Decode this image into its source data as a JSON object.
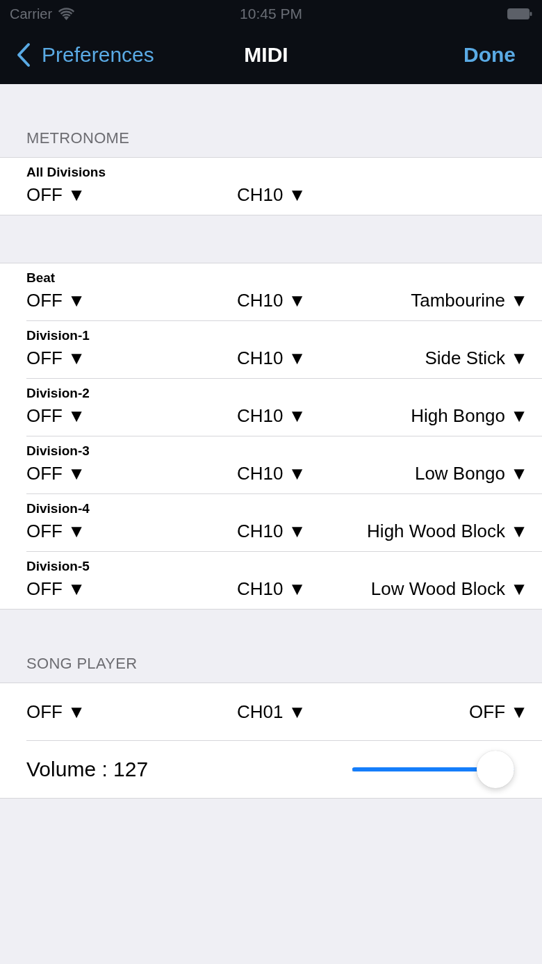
{
  "status_bar": {
    "carrier": "Carrier",
    "time": "10:45 PM"
  },
  "nav_bar": {
    "back": "Preferences",
    "title": "MIDI",
    "done": "Done"
  },
  "sections": [
    {
      "header": "METRONOME",
      "rows": [
        {
          "kind": "pickers",
          "label": "All Divisions",
          "values": [
            "OFF ▼",
            "CH10 ▼"
          ]
        }
      ]
    },
    {
      "rows": [
        {
          "kind": "pickers",
          "label": "Beat",
          "values": [
            "OFF ▼",
            "CH10 ▼",
            "Tambourine ▼"
          ]
        },
        {
          "kind": "pickers",
          "label": "Division-1",
          "values": [
            "OFF ▼",
            "CH10 ▼",
            "Side Stick ▼"
          ]
        },
        {
          "kind": "pickers",
          "label": "Division-2",
          "values": [
            "OFF ▼",
            "CH10 ▼",
            "High Bongo ▼"
          ]
        },
        {
          "kind": "pickers",
          "label": "Division-3",
          "values": [
            "OFF ▼",
            "CH10 ▼",
            "Low Bongo ▼"
          ]
        },
        {
          "kind": "pickers",
          "label": "Division-4",
          "values": [
            "OFF ▼",
            "CH10 ▼",
            "High Wood Block ▼"
          ]
        },
        {
          "kind": "pickers",
          "label": "Division-5",
          "values": [
            "OFF ▼",
            "CH10 ▼",
            "Low Wood Block ▼"
          ]
        }
      ]
    },
    {
      "header": "SONG PLAYER",
      "rows": [
        {
          "kind": "pickers",
          "values": [
            "OFF ▼",
            "CH01 ▼",
            "OFF ▼"
          ]
        },
        {
          "kind": "slider",
          "label": "Volume : 127",
          "level": 1
        }
      ]
    }
  ]
}
